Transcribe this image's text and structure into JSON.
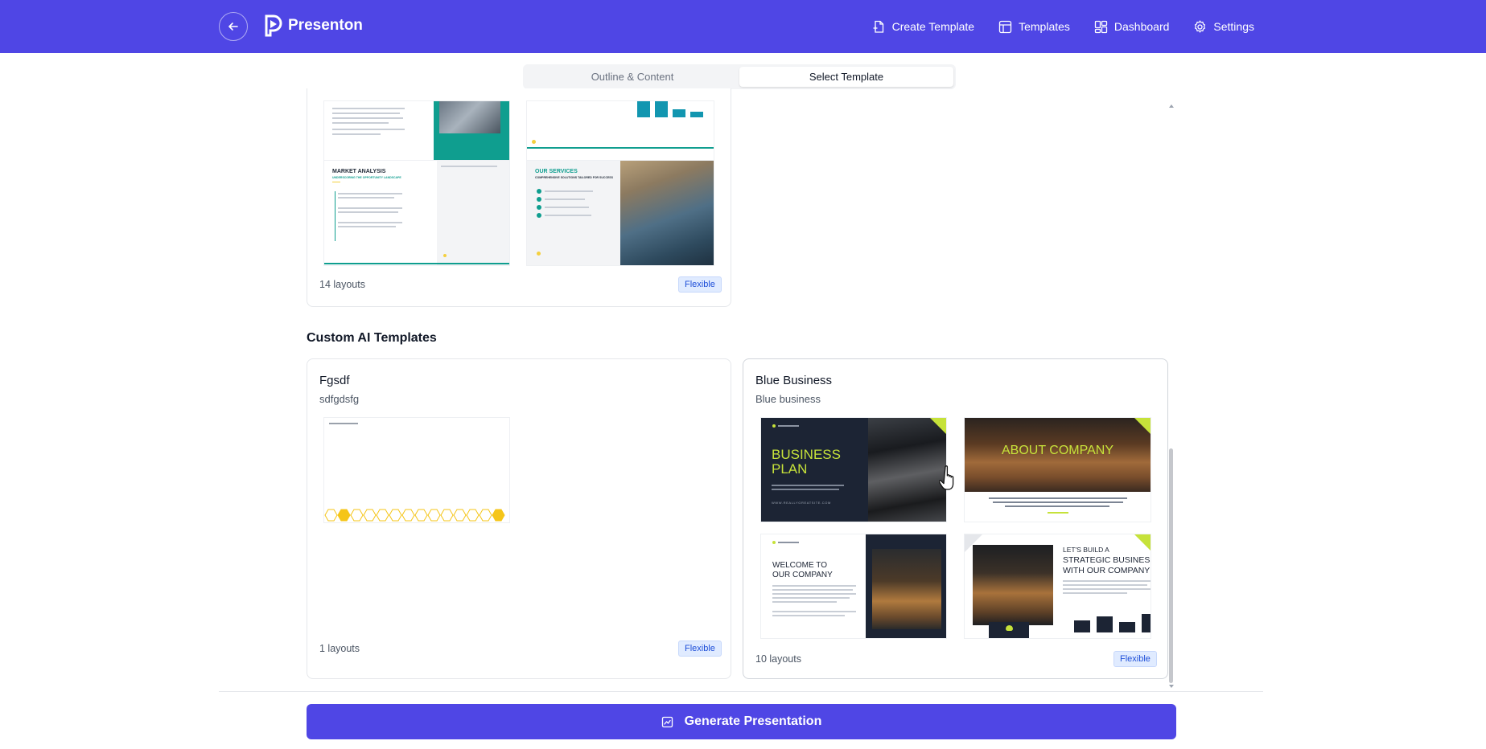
{
  "header": {
    "brand": "Presenton",
    "nav": [
      {
        "label": "Create Template",
        "icon": "file-plus-icon"
      },
      {
        "label": "Templates",
        "icon": "layout-icon"
      },
      {
        "label": "Dashboard",
        "icon": "dashboard-icon"
      },
      {
        "label": "Settings",
        "icon": "gear-icon"
      }
    ]
  },
  "tabs": [
    "Outline & Content",
    "Select Template"
  ],
  "active_tab": "Select Template",
  "top_card": {
    "layouts": "14 layouts",
    "badge": "Flexible",
    "thumbs": {
      "market_title": "MARKET ANALYSIS",
      "market_sub": "UNDERSCORING THE OPPORTUNITY LANDSCAPE",
      "services_title": "OUR SERVICES",
      "services_sub": "COMPREHENSIVE SOLUTIONS TAILORED FOR SUCCESS"
    }
  },
  "section_title": "Custom AI Templates",
  "custom_cards": [
    {
      "title": "Fgsdf",
      "desc": "sdfgdsfg",
      "layouts": "1 layouts",
      "badge": "Flexible"
    },
    {
      "title": "Blue Business",
      "desc": "Blue business",
      "layouts": "10 layouts",
      "badge": "Flexible",
      "thumbs": {
        "t1_line1": "BUSINESS",
        "t1_line2": "PLAN",
        "t1_url": "WWW.REALLYGREATSITE.COM",
        "t2_title": "ABOUT COMPANY",
        "t3_line1": "WELCOME TO",
        "t3_line2": "OUR COMPANY",
        "t4_line1": "LET'S BUILD A",
        "t4_line2": "STRATEGIC BUSINESS",
        "t4_line3": "WITH OUR COMPANY"
      }
    }
  ],
  "generate_button": "Generate Presentation",
  "colors": {
    "primary": "#4f46e5",
    "teal_accent": "#0f9e8f",
    "lime_accent": "#c6e23a",
    "navy": "#1c2434",
    "honeycomb": "#f5c518"
  }
}
